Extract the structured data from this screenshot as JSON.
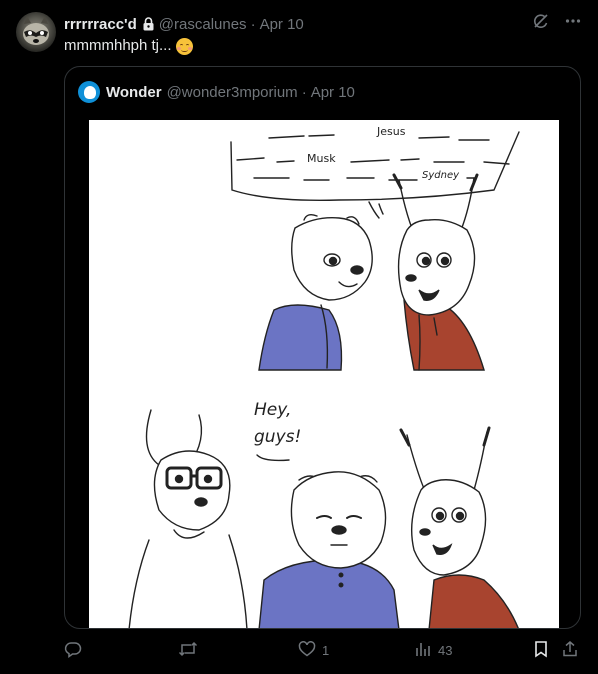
{
  "post": {
    "display_name": "rrrrrracc'd",
    "handle": "@rascalunes",
    "separator": "·",
    "date": "Apr 10",
    "text": "mmmmhhph tj...",
    "emoji_icon": "smiling-face-with-blush-icon"
  },
  "quoted_post": {
    "display_name": "Wonder",
    "handle": "@wonder3mporium",
    "separator": "·",
    "date": "Apr 10",
    "comic": {
      "panel1_words": [
        "Jesus",
        "Musk",
        "Sydney"
      ],
      "panel2_speech": [
        "Hey,",
        "guys!"
      ],
      "colors": {
        "blue": "#6b74c4",
        "red": "#a8442f"
      }
    }
  },
  "actions": {
    "reply_count": "",
    "repost_count": "",
    "like_count": "1",
    "views_count": "43"
  },
  "icons": [
    "grok-icon",
    "more-icon",
    "lock-icon",
    "reply-icon",
    "repost-icon",
    "like-icon",
    "views-icon",
    "bookmark-icon",
    "share-icon"
  ],
  "colors": {
    "background": "#000000",
    "text": "#e7e9ea",
    "muted": "#71767b",
    "border": "#2f3336"
  }
}
